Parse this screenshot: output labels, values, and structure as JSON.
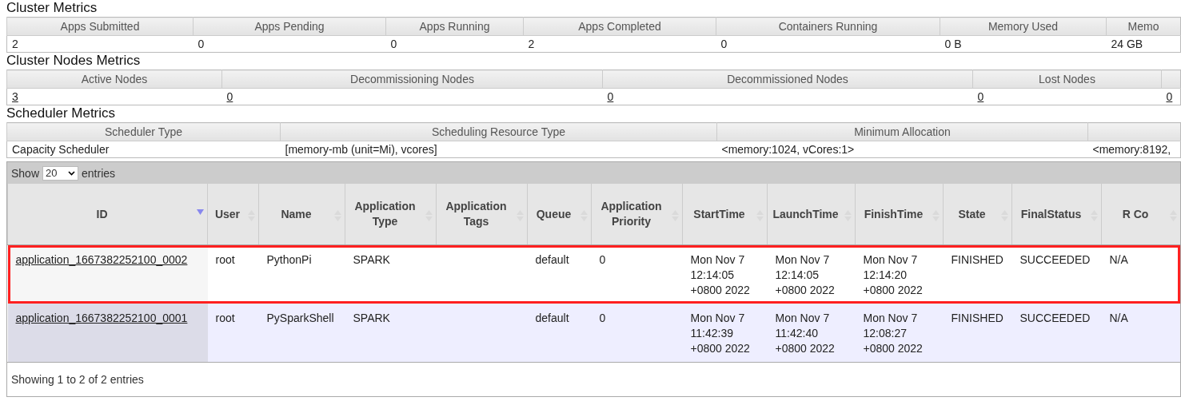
{
  "cluster_metrics": {
    "title": "Cluster Metrics",
    "columns": [
      {
        "header": "Apps Submitted",
        "value": "2"
      },
      {
        "header": "Apps Pending",
        "value": "0"
      },
      {
        "header": "Apps Running",
        "value": "0"
      },
      {
        "header": "Apps Completed",
        "value": "2"
      },
      {
        "header": "Containers Running",
        "value": "0"
      },
      {
        "header": "Memory Used",
        "value": "0 B"
      },
      {
        "header": "Memo",
        "value": "24 GB"
      }
    ]
  },
  "cluster_nodes_metrics": {
    "title": "Cluster Nodes Metrics",
    "columns": [
      {
        "header": "Active Nodes",
        "value": "3",
        "link": true
      },
      {
        "header": "Decommissioning Nodes",
        "value": "0",
        "link": true
      },
      {
        "header": "Decommissioned Nodes",
        "value": "0",
        "link": true
      },
      {
        "header": "Lost Nodes",
        "value": "0",
        "link": true
      },
      {
        "value": "0",
        "link": true
      }
    ]
  },
  "scheduler_metrics": {
    "title": "Scheduler Metrics",
    "columns": [
      {
        "header": "Scheduler Type",
        "value": "Capacity Scheduler"
      },
      {
        "header": "Scheduling Resource Type",
        "value": "[memory-mb (unit=Mi), vcores]"
      },
      {
        "header": "Minimum Allocation",
        "value": "<memory:1024, vCores:1>"
      },
      {
        "value": "<memory:8192,"
      }
    ]
  },
  "applications": {
    "show_label": "Show",
    "page_size": "20",
    "entries_label": "entries",
    "columns": [
      {
        "header": "ID",
        "sorted": true
      },
      {
        "header": "User",
        "sorted": false
      },
      {
        "header": "Name",
        "sorted": false
      },
      {
        "header": "Application Type",
        "sorted": false
      },
      {
        "header": "Application Tags",
        "sorted": false
      },
      {
        "header": "Queue",
        "sorted": false
      },
      {
        "header": "Application Priority",
        "sorted": false
      },
      {
        "header": "StartTime",
        "sorted": false
      },
      {
        "header": "LaunchTime",
        "sorted": false
      },
      {
        "header": "FinishTime",
        "sorted": false
      },
      {
        "header": "State",
        "sorted": false
      },
      {
        "header": "FinalStatus",
        "sorted": false
      },
      {
        "header": "R Co",
        "sorted": false
      }
    ],
    "rows": [
      {
        "highlighted": true,
        "cells": [
          "application_1667382252100_0002",
          "root",
          "PythonPi",
          "SPARK",
          "",
          "default",
          "0",
          "Mon Nov 7 12:14:05 +0800 2022",
          "Mon Nov 7 12:14:05 +0800 2022",
          "Mon Nov 7 12:14:20 +0800 2022",
          "FINISHED",
          "SUCCEEDED",
          "N/A"
        ]
      },
      {
        "highlighted": false,
        "cells": [
          "application_1667382252100_0001",
          "root",
          "PySparkShell",
          "SPARK",
          "",
          "default",
          "0",
          "Mon Nov 7 11:42:39 +0800 2022",
          "Mon Nov 7 11:42:40 +0800 2022",
          "Mon Nov 7 12:08:27 +0800 2022",
          "FINISHED",
          "SUCCEEDED",
          "N/A"
        ]
      }
    ],
    "footer": "Showing 1 to 2 of 2 entries"
  }
}
